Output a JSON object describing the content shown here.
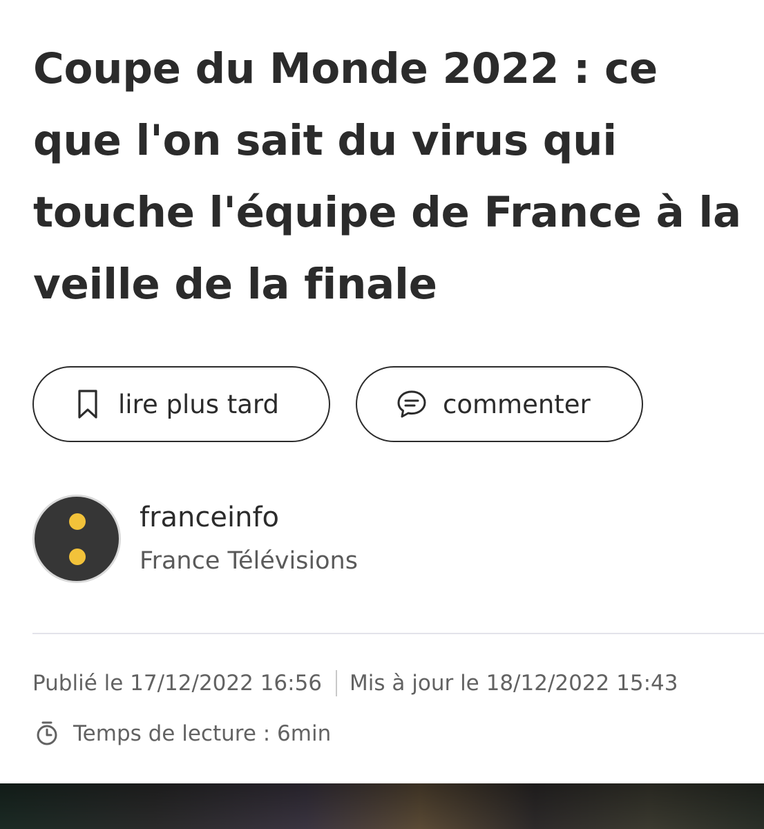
{
  "article": {
    "headline": "Coupe du Monde 2022 : ce que l'on sait du virus qui touche l'équipe de France à la veille de la finale"
  },
  "actions": {
    "read_later_label": "lire plus tard",
    "read_later_icon": "bookmark-icon",
    "comment_label": "commenter",
    "comment_icon": "comment-bubble-icon"
  },
  "source": {
    "name": "franceinfo",
    "organization": "France Télévisions",
    "logo_colors": {
      "background": "#363636",
      "dots": "#f2c23a"
    }
  },
  "meta": {
    "published": "Publié le 17/12/2022 16:56",
    "updated": "Mis à jour le 18/12/2022 15:43",
    "reading_time": "Temps de lecture : 6min",
    "reading_time_icon": "stopwatch-icon"
  }
}
